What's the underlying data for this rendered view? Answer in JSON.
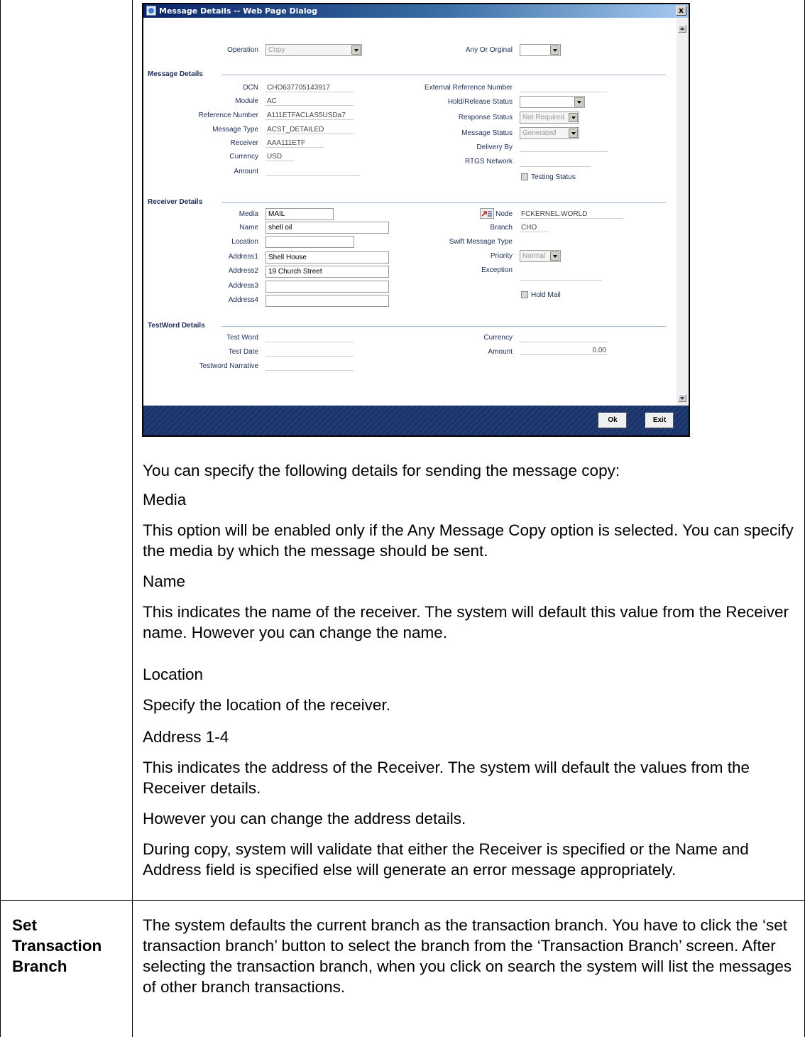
{
  "dialog": {
    "title": "Message Details -- Web Page Dialog",
    "close_label": "x",
    "operation_label": "Operation",
    "operation_value": "Copy",
    "any_or_original_label": "Any Or Orginal",
    "any_or_original_value": "",
    "message_details": {
      "heading": "Message Details",
      "dcn_label": "DCN",
      "dcn": "CHO637705143917",
      "module_label": "Module",
      "module": "AC",
      "reference_label": "Reference Number",
      "reference": "A111ETFACLAS5USDa7",
      "message_type_label": "Message Type",
      "message_type": "ACST_DETAILED",
      "receiver_label": "Receiver",
      "receiver": "AAA111ETF",
      "currency_label": "Currency",
      "currency": "USD",
      "amount_label": "Amount",
      "amount": "",
      "external_ref_label": "External Reference Number",
      "hold_release_label": "Hold/Release Status",
      "hold_release": "",
      "response_status_label": "Response Status",
      "response_status": "Not Required",
      "message_status_label": "Message Status",
      "message_status": "Generated",
      "delivery_by_label": "Delivery By",
      "rtgs_label": "RTGS Network",
      "testing_status_label": "Testing Status"
    },
    "receiver_details": {
      "heading": "Receiver Details",
      "media_label": "Media",
      "media": "MAIL",
      "name_label": "Name",
      "name": "shell oil",
      "location_label": "Location",
      "location": "",
      "address1_label": "Address1",
      "address1": "Shell House",
      "address2_label": "Address2",
      "address2": "19 Church Street",
      "address3_label": "Address3",
      "address3": "",
      "address4_label": "Address4",
      "address4": "",
      "node_label": "Node",
      "node": "FCKERNEL.WORLD",
      "branch_label": "Branch",
      "branch": "CHO",
      "swift_type_label": "Swift Message Type",
      "priority_label": "Priority",
      "priority": "Normal",
      "exception_label": "Exception",
      "hold_mail_label": "Hold Mail"
    },
    "testword_details": {
      "heading": "TestWord Details",
      "test_word_label": "Test Word",
      "test_date_label": "Test Date",
      "narrative_label": "Testword Narrative",
      "currency_label": "Currency",
      "amount_label": "Amount",
      "amount": "0.00"
    },
    "ok_label": "Ok",
    "exit_label": "Exit"
  },
  "doc": {
    "p1": "You can specify the following details for sending the message copy:",
    "h_media": "Media",
    "p_media": "This option will be enabled only if the Any Message Copy option is selected. You can specify the media by which the message should be sent.",
    "h_name": "Name",
    "p_name": "This indicates the name of the receiver. The system will default this value from the Receiver name. However you can change the name.",
    "h_location": "Location",
    "p_location": "Specify the location of the receiver.",
    "h_address": "Address 1-4",
    "p_address": "This indicates the address of the Receiver. The system will default the values from the Receiver details.",
    "p_address2": "However you can change the address details.",
    "p_copy": "During copy, system will validate that either the Receiver is specified or the Name and Address field is specified else will generate an error message appropriately.",
    "row2_label": "Set Transaction Branch",
    "row2_text": "The system defaults the current branch as the transaction branch. You have to click the ‘set transaction branch’ button to select the branch from the ‘Transaction Branch’ screen. After selecting the transaction branch, when you click on search the system will list the messages of other branch transactions."
  }
}
